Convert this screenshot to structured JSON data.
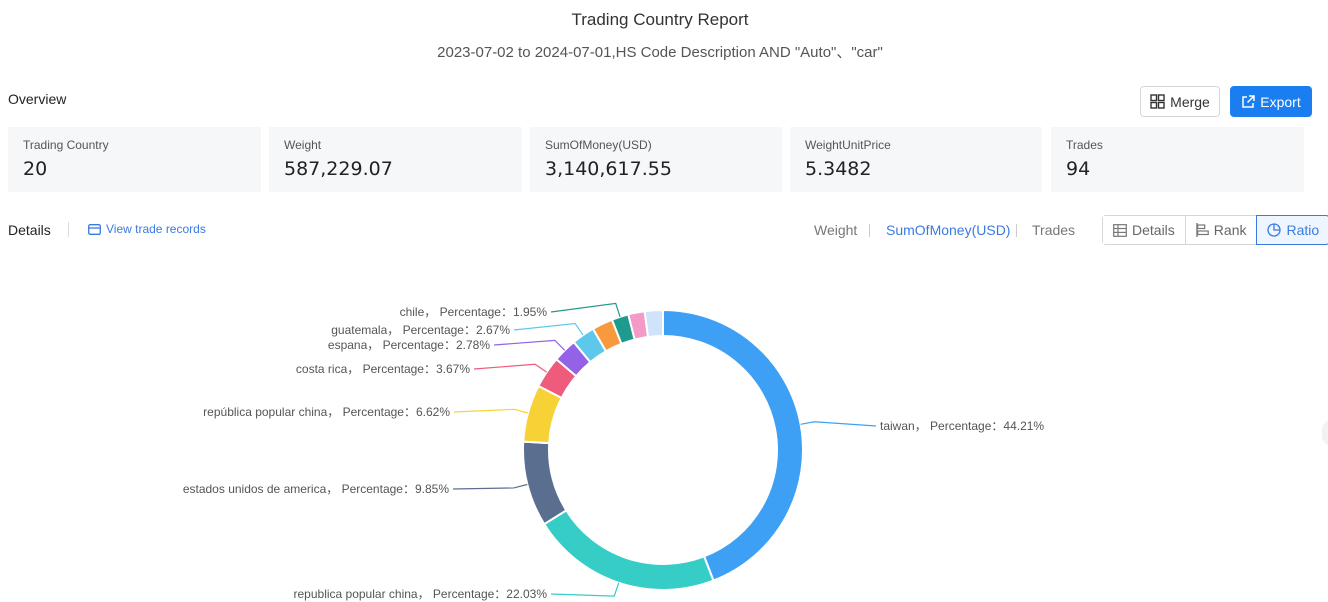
{
  "header": {
    "title": "Trading Country Report",
    "subtitle": "2023-07-02 to 2024-07-01,HS Code Description AND \"Auto\"、\"car\""
  },
  "overview": {
    "label": "Overview",
    "merge_label": "Merge",
    "export_label": "Export",
    "cards": [
      {
        "label": "Trading Country",
        "value": "20"
      },
      {
        "label": "Weight",
        "value": "587,229.07"
      },
      {
        "label": "SumOfMoney(USD)",
        "value": "3,140,617.55"
      },
      {
        "label": "WeightUnitPrice",
        "value": "5.3482"
      },
      {
        "label": "Trades",
        "value": "94"
      }
    ]
  },
  "details": {
    "label": "Details",
    "view_trade_records": "View trade records",
    "metric_tabs": [
      "Weight",
      "SumOfMoney(USD)",
      "Trades"
    ],
    "active_metric": "SumOfMoney(USD)",
    "view_buttons": [
      "Details",
      "Rank",
      "Ratio"
    ],
    "active_view": "Ratio"
  },
  "chart_data": {
    "type": "pie",
    "style": "donut",
    "label_format": "{name}, Percentage : {value}%",
    "slices": [
      {
        "name": "taiwan",
        "value": 44.21,
        "color": "#3ea0f5"
      },
      {
        "name": "republica popular china",
        "value": 22.03,
        "color": "#35cdc6"
      },
      {
        "name": "estados unidos de america",
        "value": 9.85,
        "color": "#5a6f90"
      },
      {
        "name": "república popular china",
        "value": 6.62,
        "color": "#f7d237"
      },
      {
        "name": "costa rica",
        "value": 3.67,
        "color": "#ef5b7a"
      },
      {
        "name": "espana",
        "value": 2.78,
        "color": "#9362e6"
      },
      {
        "name": "guatemala",
        "value": 2.67,
        "color": "#5ec8ec"
      },
      {
        "name": "",
        "value": 2.4,
        "color": "#f79a3e"
      },
      {
        "name": "chile",
        "value": 1.95,
        "color": "#1f9a8e"
      },
      {
        "name": "",
        "value": 1.9,
        "color": "#f39bc8"
      },
      {
        "name": "",
        "value": 2.1,
        "color": "#cfe4fb"
      }
    ]
  }
}
